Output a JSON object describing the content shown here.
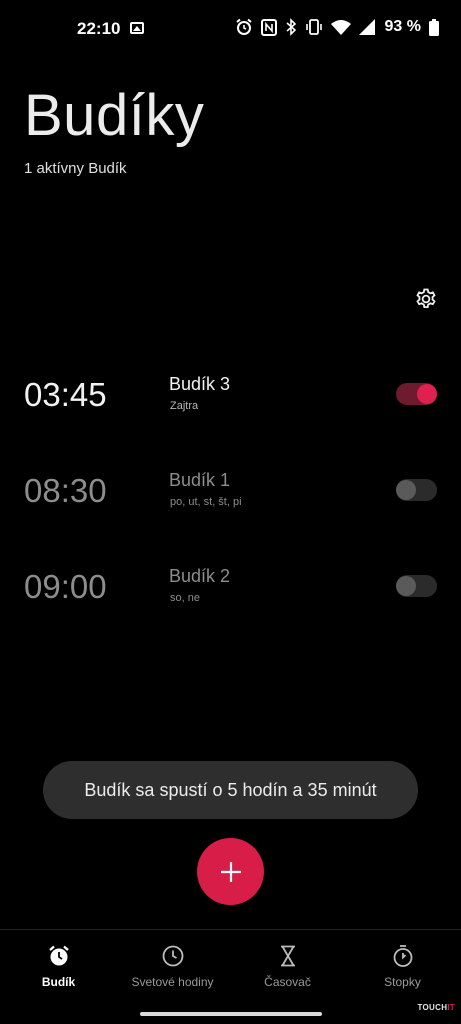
{
  "status_bar": {
    "time": "22:10",
    "battery_percent": "93 %",
    "icons": [
      "image-icon",
      "alarm-icon",
      "nfc-icon",
      "bluetooth-icon",
      "vibrate-icon",
      "wifi-icon",
      "signal-icon",
      "battery-icon"
    ]
  },
  "header": {
    "title": "Budíky",
    "subtitle": "1 aktívny Budík"
  },
  "alarms": [
    {
      "time": "03:45",
      "name": "Budík 3",
      "days": "Zajtra",
      "enabled": true
    },
    {
      "time": "08:30",
      "name": "Budík 1",
      "days": "po,  ut,  st,  št,  pi",
      "enabled": false
    },
    {
      "time": "09:00",
      "name": "Budík 2",
      "days": "so,  ne",
      "enabled": false
    }
  ],
  "snackbar": {
    "text": "Budík sa spustí o 5 hodín a 35 minút"
  },
  "fab": {
    "icon": "plus-icon"
  },
  "bottom_nav": {
    "items": [
      {
        "label": "Budík",
        "icon": "alarm-clock-icon",
        "active": true
      },
      {
        "label": "Svetové hodiny",
        "icon": "clock-icon",
        "active": false
      },
      {
        "label": "Časovač",
        "icon": "hourglass-icon",
        "active": false
      },
      {
        "label": "Stopky",
        "icon": "stopwatch-icon",
        "active": false
      }
    ]
  },
  "watermark": {
    "prefix": "TOUCH",
    "suffix": "IT"
  },
  "colors": {
    "accent": "#d81e48",
    "background": "#000000",
    "snackbar": "#2e2e2e"
  }
}
